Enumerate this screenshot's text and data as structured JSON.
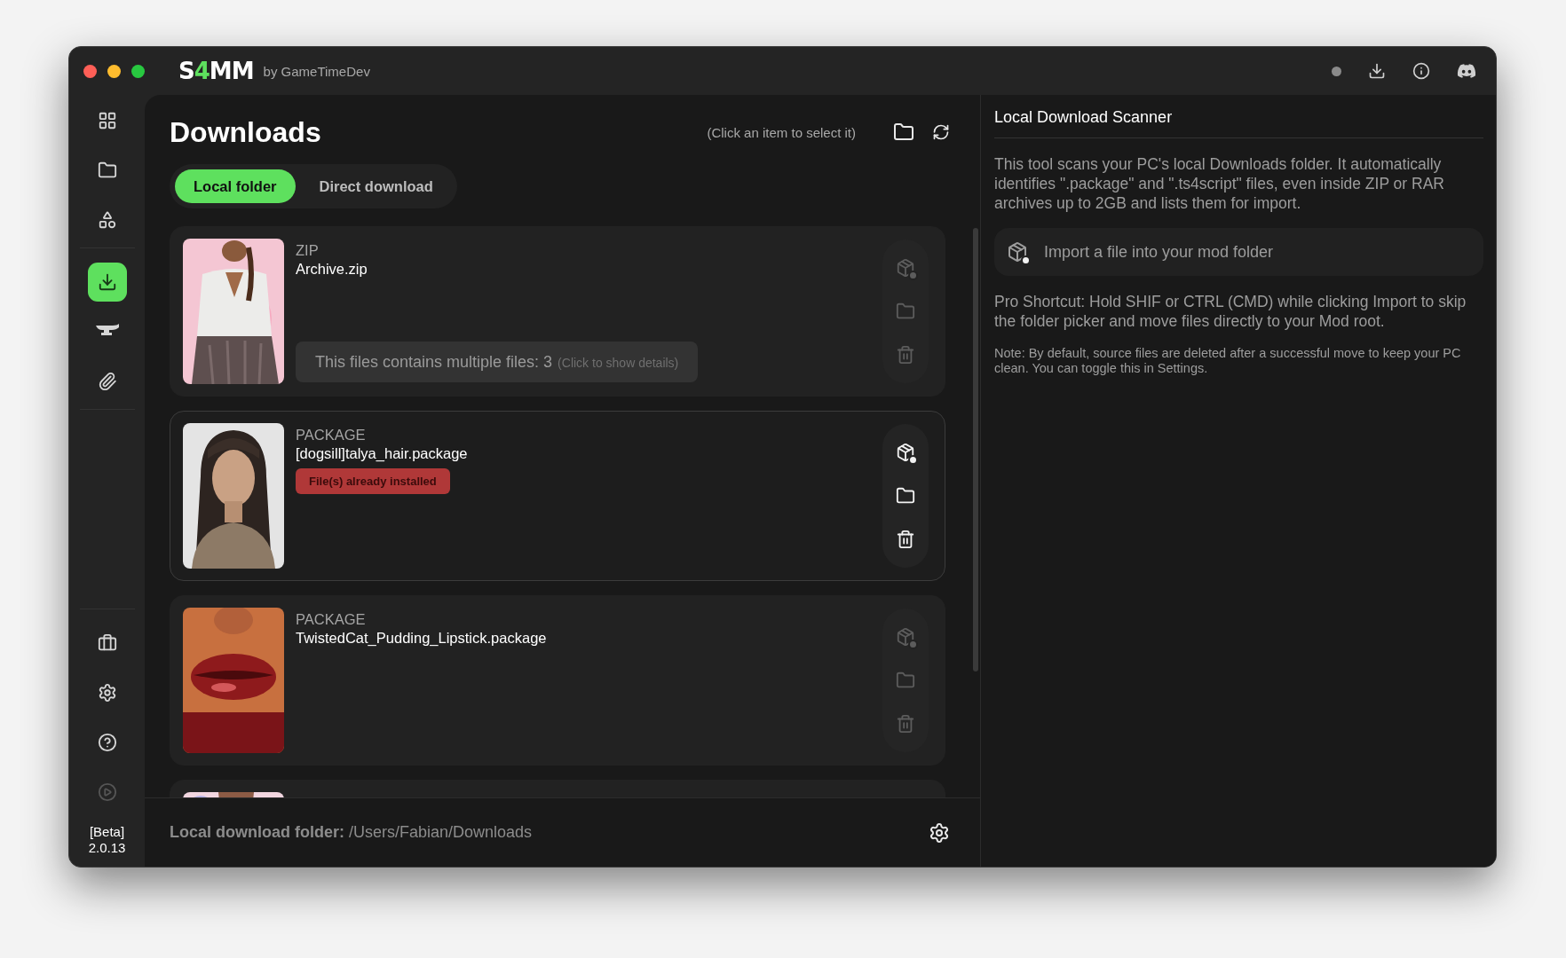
{
  "app": {
    "logo": [
      {
        "text": "S",
        "accent": false
      },
      {
        "text": "4",
        "accent": true
      },
      {
        "text": "MM",
        "accent": false
      }
    ],
    "byline": "by GameTimeDev"
  },
  "sidebar": {
    "groups": [
      [
        {
          "kind": "dashboard",
          "selected": false,
          "disabled": false
        },
        {
          "kind": "folder",
          "selected": false,
          "disabled": false
        },
        {
          "kind": "shapes",
          "selected": false,
          "disabled": false
        }
      ],
      [
        {
          "kind": "download",
          "selected": true,
          "disabled": false
        },
        {
          "kind": "anvil",
          "selected": false,
          "disabled": false
        },
        {
          "kind": "paperclip",
          "selected": false,
          "disabled": false
        }
      ]
    ],
    "bottom": [
      {
        "kind": "toolbox",
        "selected": false,
        "disabled": false
      },
      {
        "kind": "settings",
        "selected": false,
        "disabled": false
      },
      {
        "kind": "help",
        "selected": false,
        "disabled": false
      },
      {
        "kind": "play",
        "selected": false,
        "disabled": true
      }
    ],
    "version_label": "[Beta]",
    "version": "2.0.13"
  },
  "page": {
    "title": "Downloads",
    "hint": "(Click an item to select it)",
    "tabs": [
      {
        "label": "Local folder",
        "selected": true
      },
      {
        "label": "Direct download",
        "selected": false
      }
    ]
  },
  "items": [
    {
      "type": "ZIP",
      "name": "Archive.zip",
      "selected": false,
      "multi_files": {
        "text": "This files contains multiple files: 3",
        "details": "(Click to show details)"
      }
    },
    {
      "type": "PACKAGE",
      "name": "[dogsill]talya_hair.package",
      "selected": true,
      "badge": "File(s) already installed"
    },
    {
      "type": "PACKAGE",
      "name": "TwistedCat_Pudding_Lipstick.package",
      "selected": false
    },
    {
      "selected": false
    }
  ],
  "footer": {
    "folder": "**Local download folder:** /Users/Fabian/Downloads"
  },
  "scanner": {
    "title": "Local Download Scanner",
    "description": "This tool scans your PC's local Downloads folder. It automatically identifies \".package\" and \".ts4script\" files, even inside ZIP or RAR archives up to 2GB and lists them for import.",
    "import_button": "Import a file into your mod folder",
    "shortcut": "Pro Shortcut: Hold SHIF or CTRL (CMD) while clicking Import to skip the folder picker and move files directly to your Mod root.",
    "note": "Note: By default, source files are deleted after a successful move to keep your PC clean. You can toggle this in Settings."
  }
}
